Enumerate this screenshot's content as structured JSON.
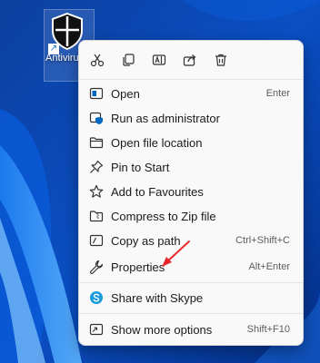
{
  "desktop": {
    "icon_label": "Antivirus Scan",
    "shortcut_glyph": "↗",
    "icon_name": "shield-icon"
  },
  "context_menu": {
    "toolbar": [
      {
        "name": "cut-icon"
      },
      {
        "name": "copy-icon"
      },
      {
        "name": "rename-icon"
      },
      {
        "name": "share-icon"
      },
      {
        "name": "delete-icon"
      }
    ],
    "items": [
      {
        "label": "Open",
        "shortcut": "Enter",
        "icon": "open-icon"
      },
      {
        "label": "Run as administrator",
        "shortcut": "",
        "icon": "admin-shield-icon"
      },
      {
        "label": "Open file location",
        "shortcut": "",
        "icon": "folder-icon"
      },
      {
        "label": "Pin to Start",
        "shortcut": "",
        "icon": "pin-icon"
      },
      {
        "label": "Add to Favourites",
        "shortcut": "",
        "icon": "star-icon"
      },
      {
        "label": "Compress to Zip file",
        "shortcut": "",
        "icon": "zip-icon"
      },
      {
        "label": "Copy as path",
        "shortcut": "Ctrl+Shift+C",
        "icon": "copy-path-icon"
      },
      {
        "label": "Properties",
        "shortcut": "Alt+Enter",
        "icon": "wrench-icon"
      },
      {
        "label": "Share with Skype",
        "shortcut": "",
        "icon": "skype-icon"
      },
      {
        "label": "Show more options",
        "shortcut": "Shift+F10",
        "icon": "more-options-icon"
      }
    ]
  },
  "colors": {
    "accent": "#0067c0",
    "annotation_arrow": "#e8262a",
    "menu_bg": "#f9f9f9"
  }
}
